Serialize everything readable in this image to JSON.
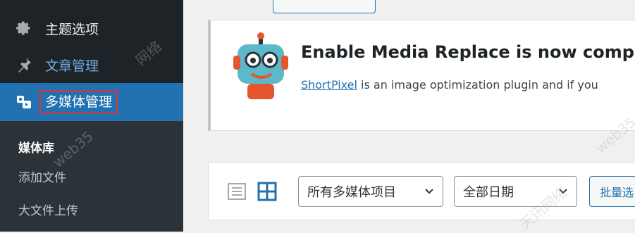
{
  "sidebar": {
    "items": [
      {
        "label": "主题选项",
        "icon": "gear-icon"
      },
      {
        "label": "文章管理",
        "icon": "pushpin-icon"
      },
      {
        "label": "多媒体管理",
        "icon": "media-icon"
      }
    ],
    "submenu": [
      {
        "label": "媒体库"
      },
      {
        "label": "添加文件"
      },
      {
        "label": "大文件上传"
      }
    ]
  },
  "notice": {
    "title": "Enable Media Replace is now compatible",
    "link_text": "ShortPixel",
    "body_text": " is an image optimization plugin and if you"
  },
  "toolbar": {
    "type_filter": "所有多媒体项目",
    "date_filter": "全部日期",
    "bulk_select": "批量选"
  },
  "watermarks": [
    "网络",
    "web35",
    "天讯网络",
    "web35"
  ],
  "colors": {
    "sidebar_bg": "#1d2327",
    "active_bg": "#2271b1",
    "highlight_border": "#d63638",
    "link": "#2271b1"
  }
}
